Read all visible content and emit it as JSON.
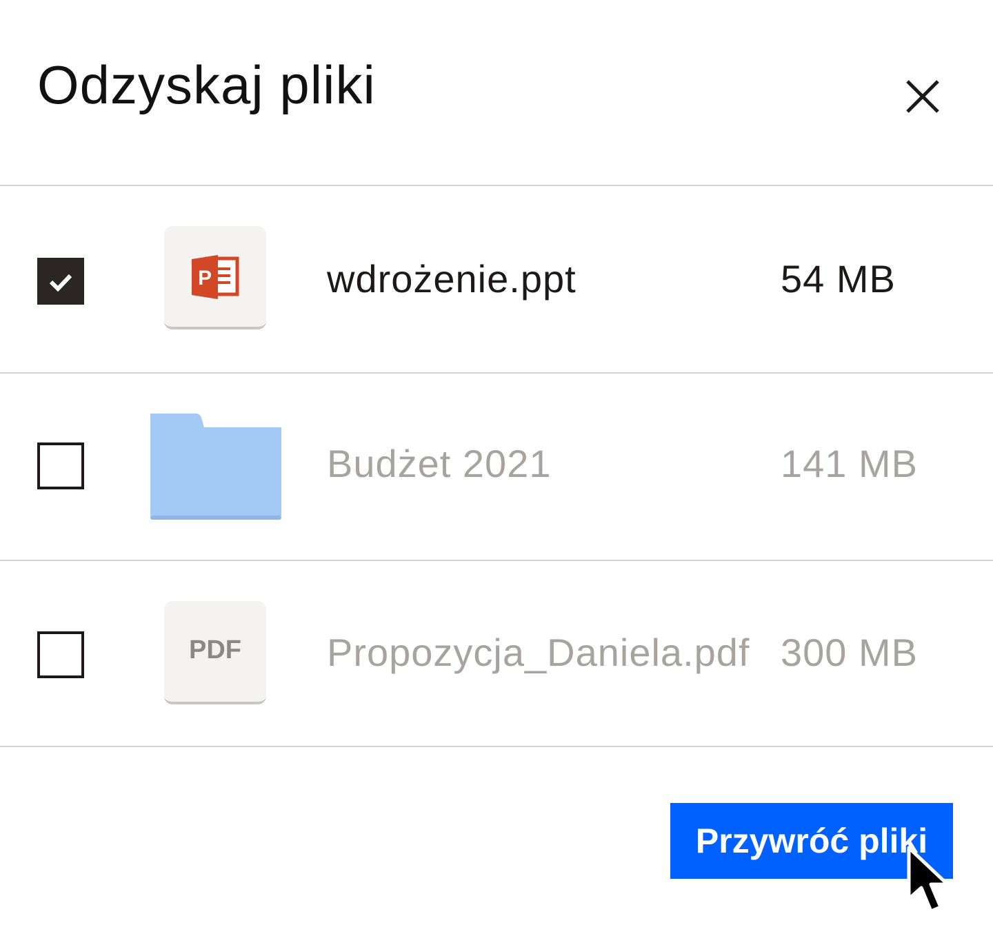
{
  "dialog": {
    "title": "Odzyskaj pliki",
    "close_icon": "close-icon"
  },
  "files": [
    {
      "name": "wdrożenie.ppt",
      "size": "54 MB",
      "checked": true,
      "icon": "powerpoint-icon"
    },
    {
      "name": "Budżet 2021",
      "size": "141 MB",
      "checked": false,
      "icon": "folder-icon"
    },
    {
      "name": "Propozycja_Daniela.pdf",
      "size": "300 MB",
      "checked": false,
      "icon": "pdf-icon",
      "icon_text": "PDF"
    }
  ],
  "footer": {
    "restore_label": "Przywróć pliki"
  },
  "colors": {
    "accent": "#0061fe",
    "checkbox_checked": "#2b2524",
    "folder": "#a3c9f5",
    "powerpoint": "#d24726",
    "muted_text": "#a7a3a0"
  }
}
